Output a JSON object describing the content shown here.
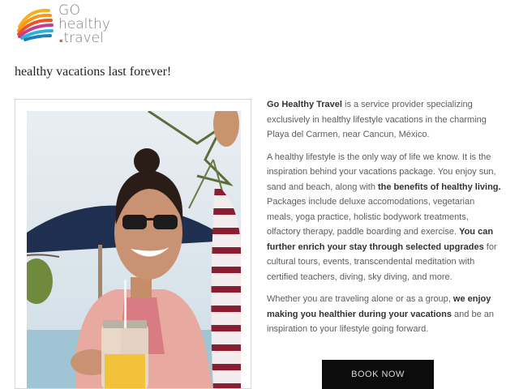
{
  "brand": {
    "logo_line1": "GO",
    "logo_line2": "healthy",
    "logo_dot": ".",
    "logo_line3": "travel",
    "colors": [
      "#f7b11f",
      "#e9542a",
      "#c63c8f",
      "#2ab3d8",
      "#1c7fb8"
    ]
  },
  "tagline": "healthy vacations last forever!",
  "photo": {
    "icon": "smiling-woman-photo"
  },
  "content": {
    "p1": {
      "brand": "Go Healthy Travel",
      "text": " is a service provider specializing exclusively in healthy lifestyle vacations in the charming Playa del Carmen, near Cancun, México."
    },
    "p2": {
      "t1": "A healthy lifestyle is the only way of life we know. It is the inspiration behind your vacations package. You enjoy sun, sand and beach, along with ",
      "b1": "the benefits of healthy living.",
      "t2": " Packages include deluxe accomodations, vegetarian meals, yoga practice, holistic bodywork treatments, olfactory therapy, paddle boarding and exercise. ",
      "b2": "You can further enrich your stay through selected upgrades",
      "t3": " for cultural tours, events, transcendental meditation with certified teachers, diving, sky diving, and more."
    },
    "p3": {
      "t1": "Whether you are traveling alone or as a group, ",
      "b1": "we enjoy making you healthier during your vacations",
      "t2": " and be an inspiration to your lifestyle going forward."
    }
  },
  "cta": {
    "label": "BOOK NOW"
  }
}
